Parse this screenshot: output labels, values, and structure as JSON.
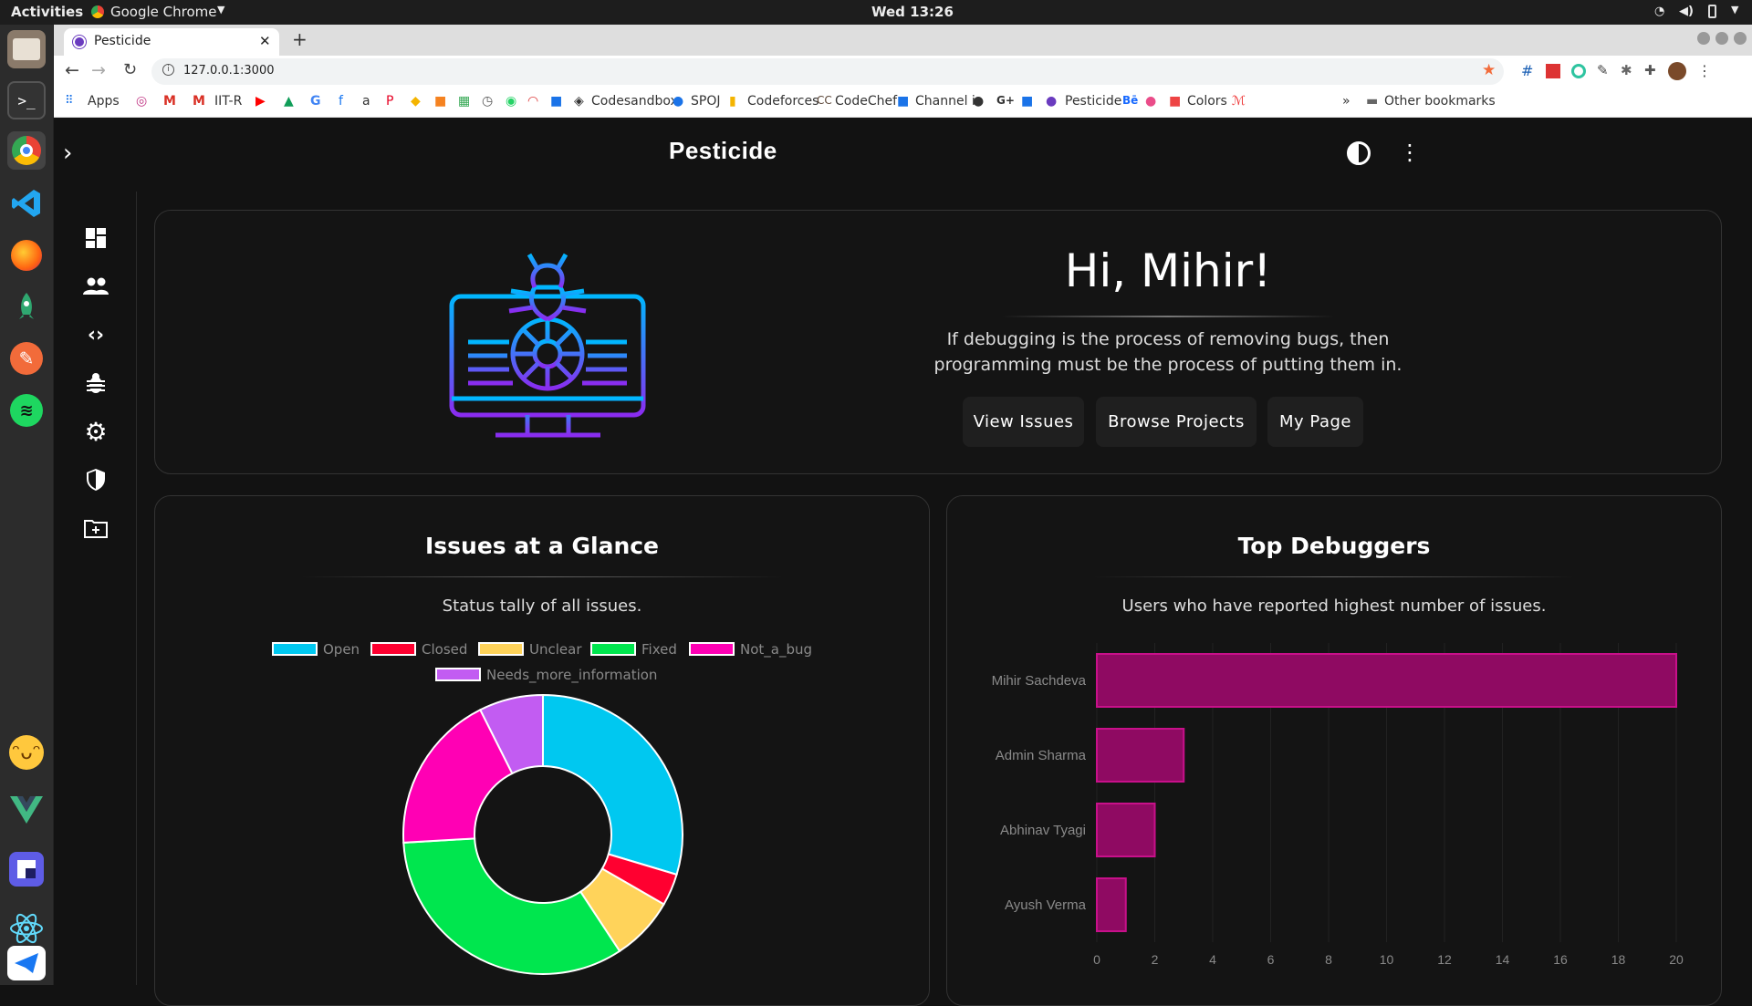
{
  "system": {
    "activities": "Activities",
    "app_name": "Google Chrome",
    "clock": "Wed 13:26"
  },
  "browser": {
    "tab_title": "Pesticide",
    "url": "127.0.0.1:3000",
    "bookmarks": [
      "Apps",
      "IIT-R",
      "Codesandbox",
      "SPOJ",
      "Codeforces",
      "CodeChef",
      "Channel i",
      "Pesticide",
      "Colors"
    ],
    "other_bookmarks": "Other bookmarks"
  },
  "app": {
    "title": "Pesticide"
  },
  "hero": {
    "greeting": "Hi, Mihir!",
    "quote_line1": "If debugging is the process of removing bugs, then",
    "quote_line2": "programming must be the process of putting them in.",
    "buttons": [
      "View Issues",
      "Browse Projects",
      "My Page"
    ]
  },
  "issues_card": {
    "title": "Issues at a Glance",
    "subtitle": "Status tally of all issues."
  },
  "debuggers_card": {
    "title": "Top Debuggers",
    "subtitle": "Users who have reported highest number of issues."
  },
  "chart_data": [
    {
      "type": "pie",
      "subtype": "doughnut",
      "labels": [
        "Open",
        "Closed",
        "Unclear",
        "Fixed",
        "Not_a_bug",
        "Needs_more_information"
      ],
      "values": [
        8,
        1,
        2,
        9,
        5,
        2
      ],
      "colors": [
        "#00c8f0",
        "#ff0030",
        "#ffd35a",
        "#00e64e",
        "#ff00b4",
        "#c25cf2"
      ],
      "legend": "top"
    },
    {
      "type": "bar",
      "orientation": "horizontal",
      "categories": [
        "Mihir Sachdeva",
        "Admin Sharma",
        "Abhinav Tyagi",
        "Ayush Verma"
      ],
      "values": [
        20,
        3,
        2,
        1
      ],
      "xticks": [
        "0",
        "2",
        "4",
        "6",
        "8",
        "10",
        "12",
        "14",
        "16",
        "18",
        "20"
      ],
      "xlim": [
        0,
        20
      ],
      "color": "#8f0a62"
    }
  ]
}
